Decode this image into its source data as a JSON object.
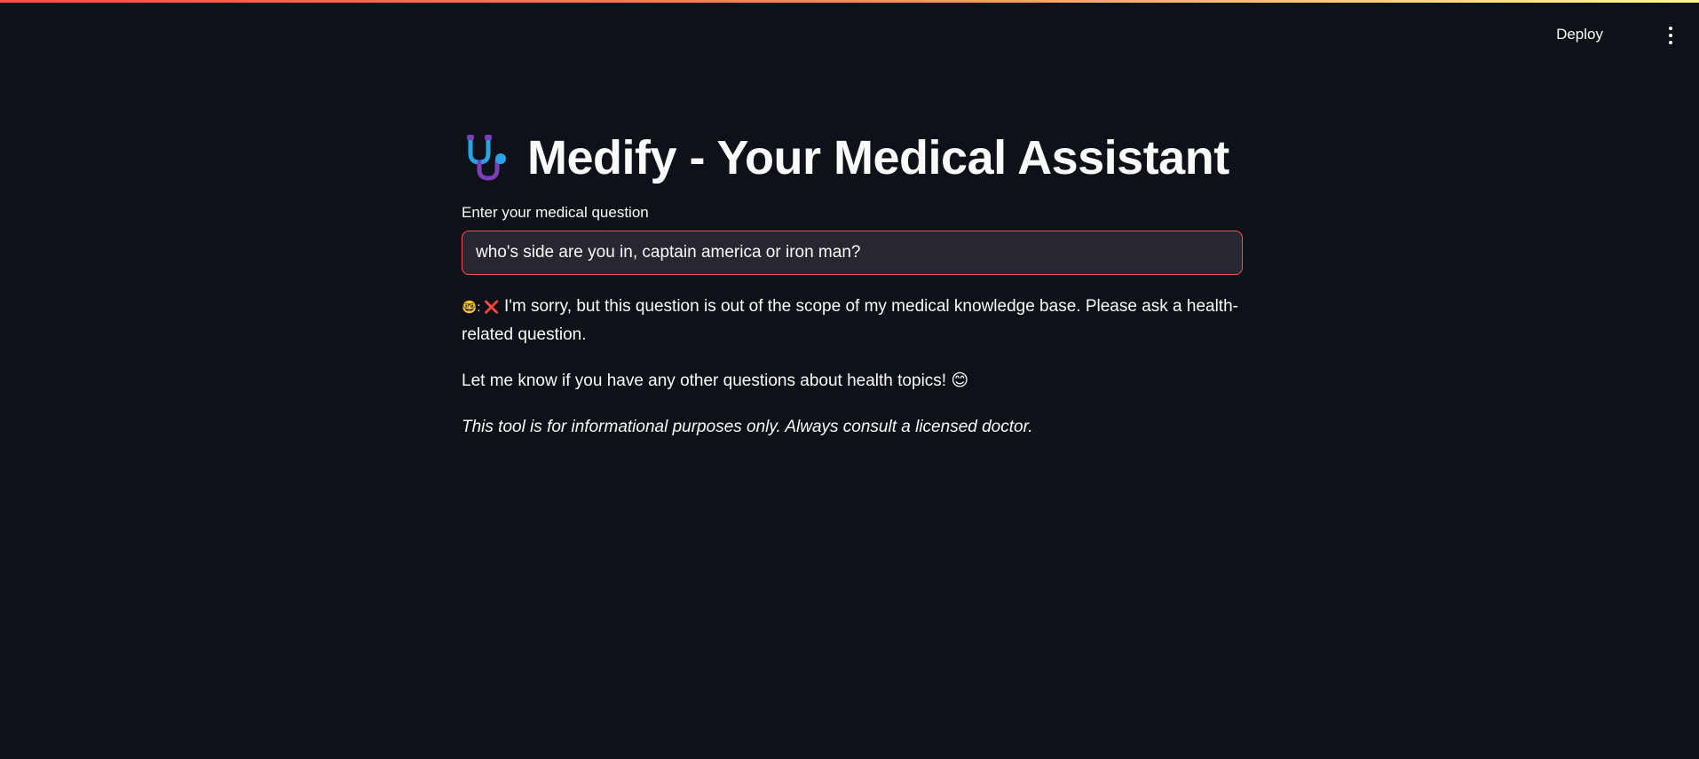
{
  "header": {
    "deploy_label": "Deploy",
    "menu_icon": "more-vertical-icon"
  },
  "main": {
    "title_icon": "stethoscope-icon",
    "title": "Medify - Your Medical Assistant",
    "input": {
      "label": "Enter your medical question",
      "value": "who's side are you in, captain america or iron man?"
    },
    "answer": {
      "prefix": "🤓: ❌",
      "line1": "I'm sorry, but this question is out of the scope of my medical knowledge base. Please ask a health-related question.",
      "line2": "Let me know if you have any other questions about health topics! 😊"
    },
    "disclaimer": "This tool is for informational purposes only. Always consult a licensed doctor."
  },
  "colors": {
    "background": "#0e1117",
    "text": "#fafafa",
    "input_background": "#262730",
    "input_border": "#ff4b4b"
  }
}
